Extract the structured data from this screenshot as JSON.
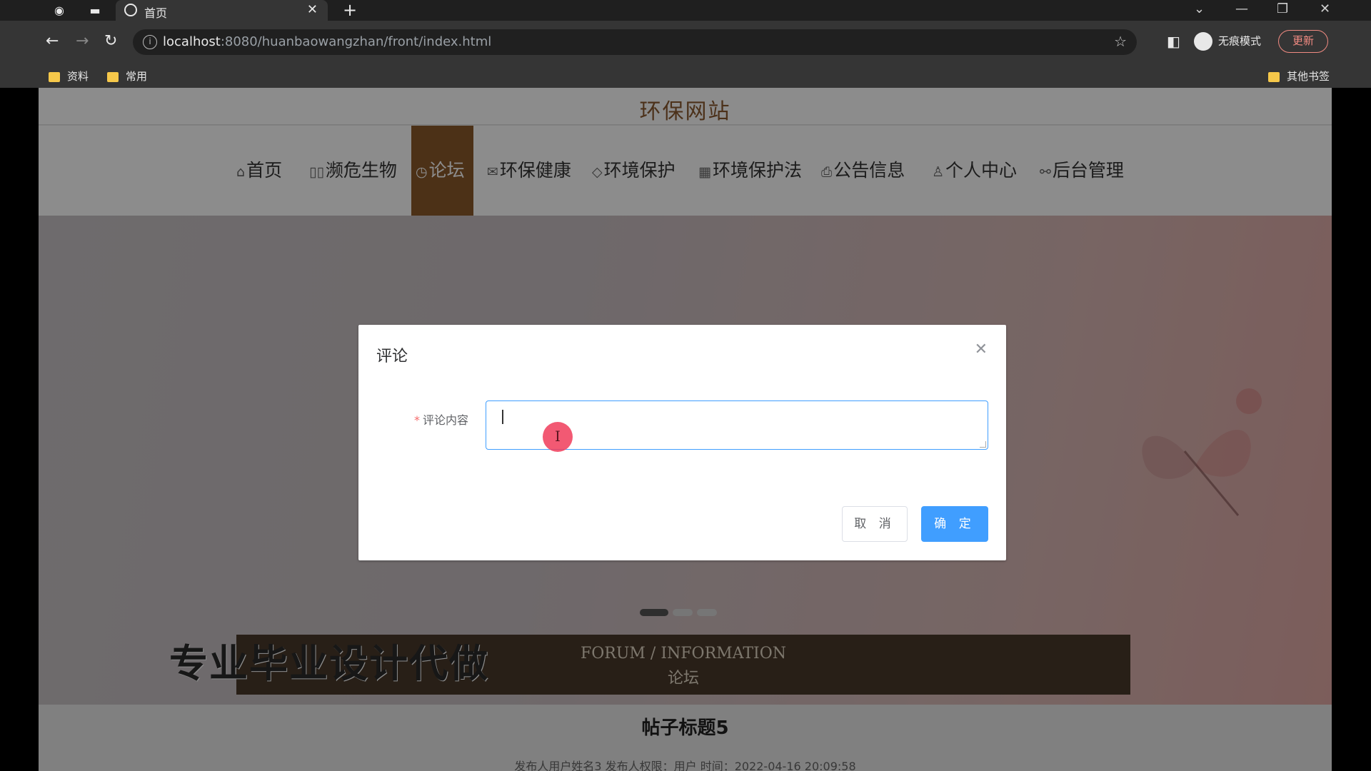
{
  "browser": {
    "tab_title": "首页",
    "url_host": "localhost",
    "url_rest": ":8080/huanbaowangzhan/front/index.html",
    "incognito_label": "无痕模式",
    "update_label": "更新",
    "bookmarks": [
      "资料",
      "常用"
    ],
    "other_bookmarks": "其他书签"
  },
  "site": {
    "title": "环保网站",
    "nav": [
      {
        "label": "首页",
        "icon": "⌂"
      },
      {
        "label": "濒危生物",
        "icon": "▯▯"
      },
      {
        "label": "论坛",
        "icon": "◷"
      },
      {
        "label": "环保健康",
        "icon": "✉"
      },
      {
        "label": "环境保护",
        "icon": "◇"
      },
      {
        "label": "环境保护法",
        "icon": "▦"
      },
      {
        "label": "公告信息",
        "icon": "⎙"
      },
      {
        "label": "个人中心",
        "icon": "♙"
      },
      {
        "label": "后台管理",
        "icon": "⚯"
      }
    ],
    "active_nav": "论坛"
  },
  "section": {
    "en": "FORUM / INFORMATION",
    "cn": "论坛"
  },
  "watermark": "专业毕业设计代做",
  "post": {
    "title": "帖子标题5",
    "meta": "发布人用户姓名3   发布人权限：用户   时间：2022-04-16 20:09:58"
  },
  "dialog": {
    "title": "评论",
    "field_label": "评论内容",
    "field_value": "",
    "cancel_label": "取 消",
    "ok_label": "确 定"
  },
  "colors": {
    "brand": "#8b5a2b",
    "primary": "#409eff",
    "section_bar": "#4a3a2b"
  }
}
